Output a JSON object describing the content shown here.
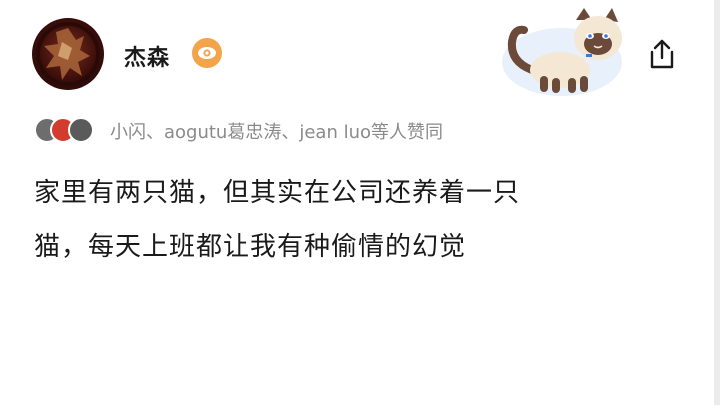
{
  "author": {
    "name": "杰森",
    "badge_icon": "eye-icon",
    "avatar_icon": "avatar-image"
  },
  "sticker": {
    "icon": "siamese-cat-sticker"
  },
  "share": {
    "icon": "share-icon"
  },
  "voters": {
    "text": "小闪、aogutu葛忠涛、jean luo等人赞同"
  },
  "post": {
    "line1": "家里有两只猫，但其实在公司还养着一只",
    "line2": "猫，每天上班都让我有种偷情的幻觉"
  },
  "colors": {
    "badge": "#f3a34a",
    "muted_text": "#8a8a8a",
    "text": "#1a1a1a",
    "sticker_bg": "#e8f0fb"
  }
}
